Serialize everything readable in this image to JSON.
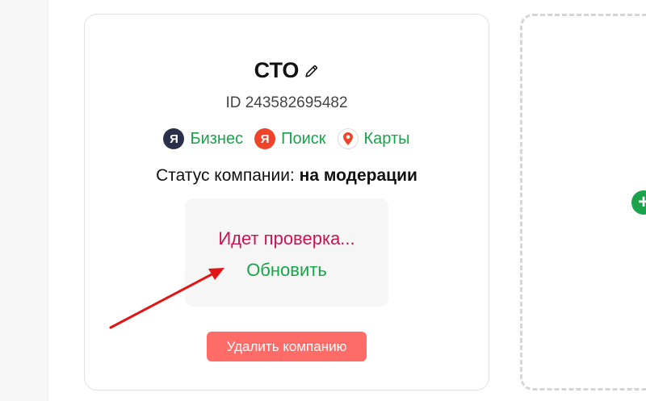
{
  "company": {
    "name": "СТО",
    "id_text": "ID 243582695482"
  },
  "services": [
    {
      "label": "Бизнес",
      "icon": "yandex-business-icon",
      "glyph": "Я"
    },
    {
      "label": "Поиск",
      "icon": "yandex-search-icon",
      "glyph": "Я"
    },
    {
      "label": "Карты",
      "icon": "yandex-maps-pin-icon"
    }
  ],
  "status": {
    "prefix": "Статус компании: ",
    "value": "на модерации"
  },
  "moderation": {
    "checking_text": "Идет проверка...",
    "refresh_label": "Обновить"
  },
  "actions": {
    "delete_label": "Удалить компанию",
    "add_glyph": "+"
  },
  "colors": {
    "accent_green": "#1aa34a",
    "checking_red": "#c8144f",
    "delete_button": "#ff6b66",
    "annotation_arrow": "#e31414"
  }
}
